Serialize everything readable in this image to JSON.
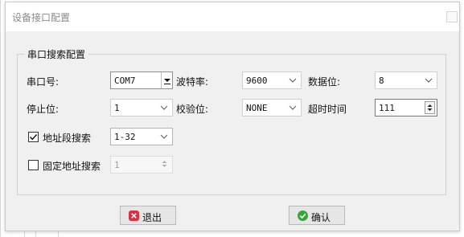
{
  "window": {
    "title": "设备接口配置"
  },
  "group": {
    "title": "串口搜索配置"
  },
  "fields": {
    "port": {
      "label": "串口号:",
      "value": "COM7"
    },
    "baud": {
      "label": "波特率:",
      "value": "9600"
    },
    "databits": {
      "label": "数据位:",
      "value": "8"
    },
    "stopbits": {
      "label": "停止位:",
      "value": "1"
    },
    "parity": {
      "label": "校验位:",
      "value": "NONE"
    },
    "timeout": {
      "label": "超时时间",
      "value": "111"
    }
  },
  "options": {
    "addr_range": {
      "label": "地址段搜索",
      "checked": true,
      "value": "1-32"
    },
    "fixed_addr": {
      "label": "固定地址搜索",
      "checked": false,
      "value": "1"
    }
  },
  "buttons": {
    "exit_label": "退出",
    "confirm_label": "确认"
  },
  "colors": {
    "exit_icon": "#d9333f",
    "confirm_icon": "#3aa537"
  },
  "icons": {
    "exit": "close-circle-icon",
    "confirm": "check-circle-icon"
  }
}
